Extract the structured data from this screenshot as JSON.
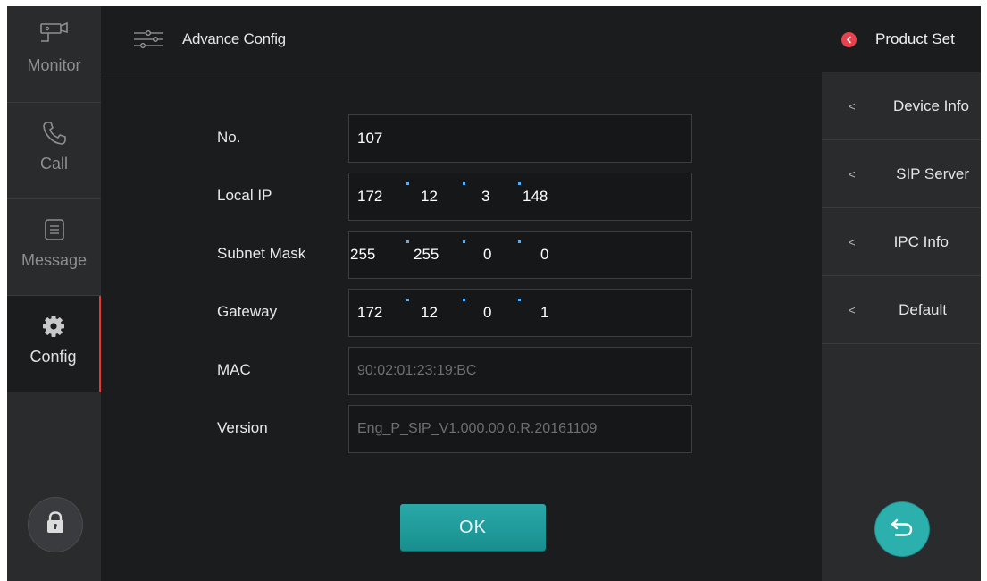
{
  "nav": {
    "items": [
      {
        "label": "Monitor",
        "icon": "camera-icon"
      },
      {
        "label": "Call",
        "icon": "phone-icon"
      },
      {
        "label": "Message",
        "icon": "message-icon"
      },
      {
        "label": "Config",
        "icon": "gear-icon"
      }
    ],
    "active": "Config"
  },
  "header": {
    "title": "Advance Config",
    "icon": "sliders-icon"
  },
  "form": {
    "no": {
      "label": "No.",
      "value": "107"
    },
    "local_ip": {
      "label": "Local IP",
      "octets": [
        "172",
        "12",
        "3",
        "148"
      ]
    },
    "subnet_mask": {
      "label": "Subnet Mask",
      "octets": [
        "255",
        "255",
        "0",
        "0"
      ]
    },
    "gateway": {
      "label": "Gateway",
      "octets": [
        "172",
        "12",
        "0",
        "1"
      ]
    },
    "mac": {
      "label": "MAC",
      "value": "90:02:01:23:19:BC"
    },
    "version": {
      "label": "Version",
      "value": "Eng_P_SIP_V1.000.00.0.R.20161109"
    }
  },
  "ok_label": "OK",
  "right_panel": {
    "title": "Product Set",
    "items": [
      "Device Info",
      "SIP Server",
      "IPC Info",
      "Default"
    ]
  },
  "colors": {
    "accent": "#2bb0ad",
    "active_indicator": "#e53935",
    "product_set_dot": "#e9424d",
    "background": "#1b1c1e",
    "panel": "#2a2b2d"
  }
}
